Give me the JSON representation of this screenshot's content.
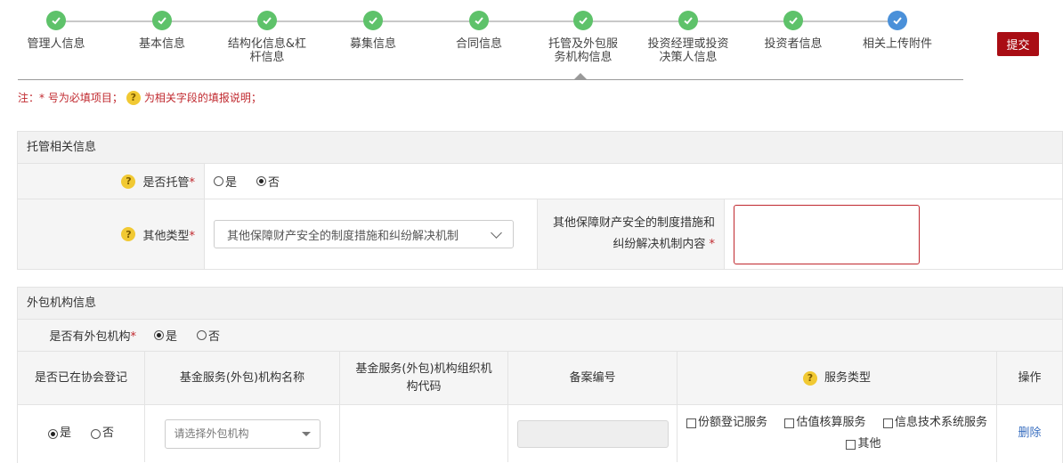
{
  "stepper": {
    "steps": [
      {
        "label": "管理人信息",
        "status": "done"
      },
      {
        "label": "基本信息",
        "status": "done"
      },
      {
        "label": "结构化信息&杠杆信息",
        "status": "done"
      },
      {
        "label": "募集信息",
        "status": "done"
      },
      {
        "label": "合同信息",
        "status": "done"
      },
      {
        "label": "托管及外包服务机构信息",
        "status": "done"
      },
      {
        "label": "投资经理或投资决策人信息",
        "status": "done"
      },
      {
        "label": "投资者信息",
        "status": "done"
      },
      {
        "label": "相关上传附件",
        "status": "current"
      }
    ],
    "active_index": 5
  },
  "submit_label": "提交",
  "note": {
    "prefix": "注：* 号为必填项目；",
    "icon_label": "?",
    "suffix": "为相关字段的填报说明；"
  },
  "custody": {
    "title": "托管相关信息",
    "is_custody_label": "是否托管",
    "req_mark": "*",
    "options": {
      "yes": "是",
      "no": "否"
    },
    "selected": "no",
    "other_type_label": "其他类型",
    "other_type_value": "其他保障财产安全的制度措施和纠纷解决机制",
    "content_label_line1": "其他保障财产安全的制度措施和",
    "content_label_line2": "纠纷解决机制内容"
  },
  "outsourcing": {
    "title": "外包机构信息",
    "has_outsourcing_label": "是否有外包机构",
    "req_mark": "*",
    "options": {
      "yes": "是",
      "no": "否"
    },
    "selected": "yes",
    "columns": {
      "registered": "是否已在协会登记",
      "name": "基金服务(外包)机构名称",
      "org_code": "基金服务(外包)机构组织机构代码",
      "record_no": "备案编号",
      "service_type": "服务类型",
      "action": "操作"
    },
    "row": {
      "registered_selected": "yes",
      "yes": "是",
      "no": "否",
      "name_placeholder": "请选择外包机构",
      "services": [
        "份额登记服务",
        "估值核算服务",
        "信息技术系统服务",
        "其他"
      ],
      "delete_label": "删除"
    }
  },
  "colors": {
    "done": "#5ec26a",
    "current": "#4a90d9",
    "required": "#c0282e",
    "submit": "#a90d14",
    "link": "#3a6fc0"
  }
}
